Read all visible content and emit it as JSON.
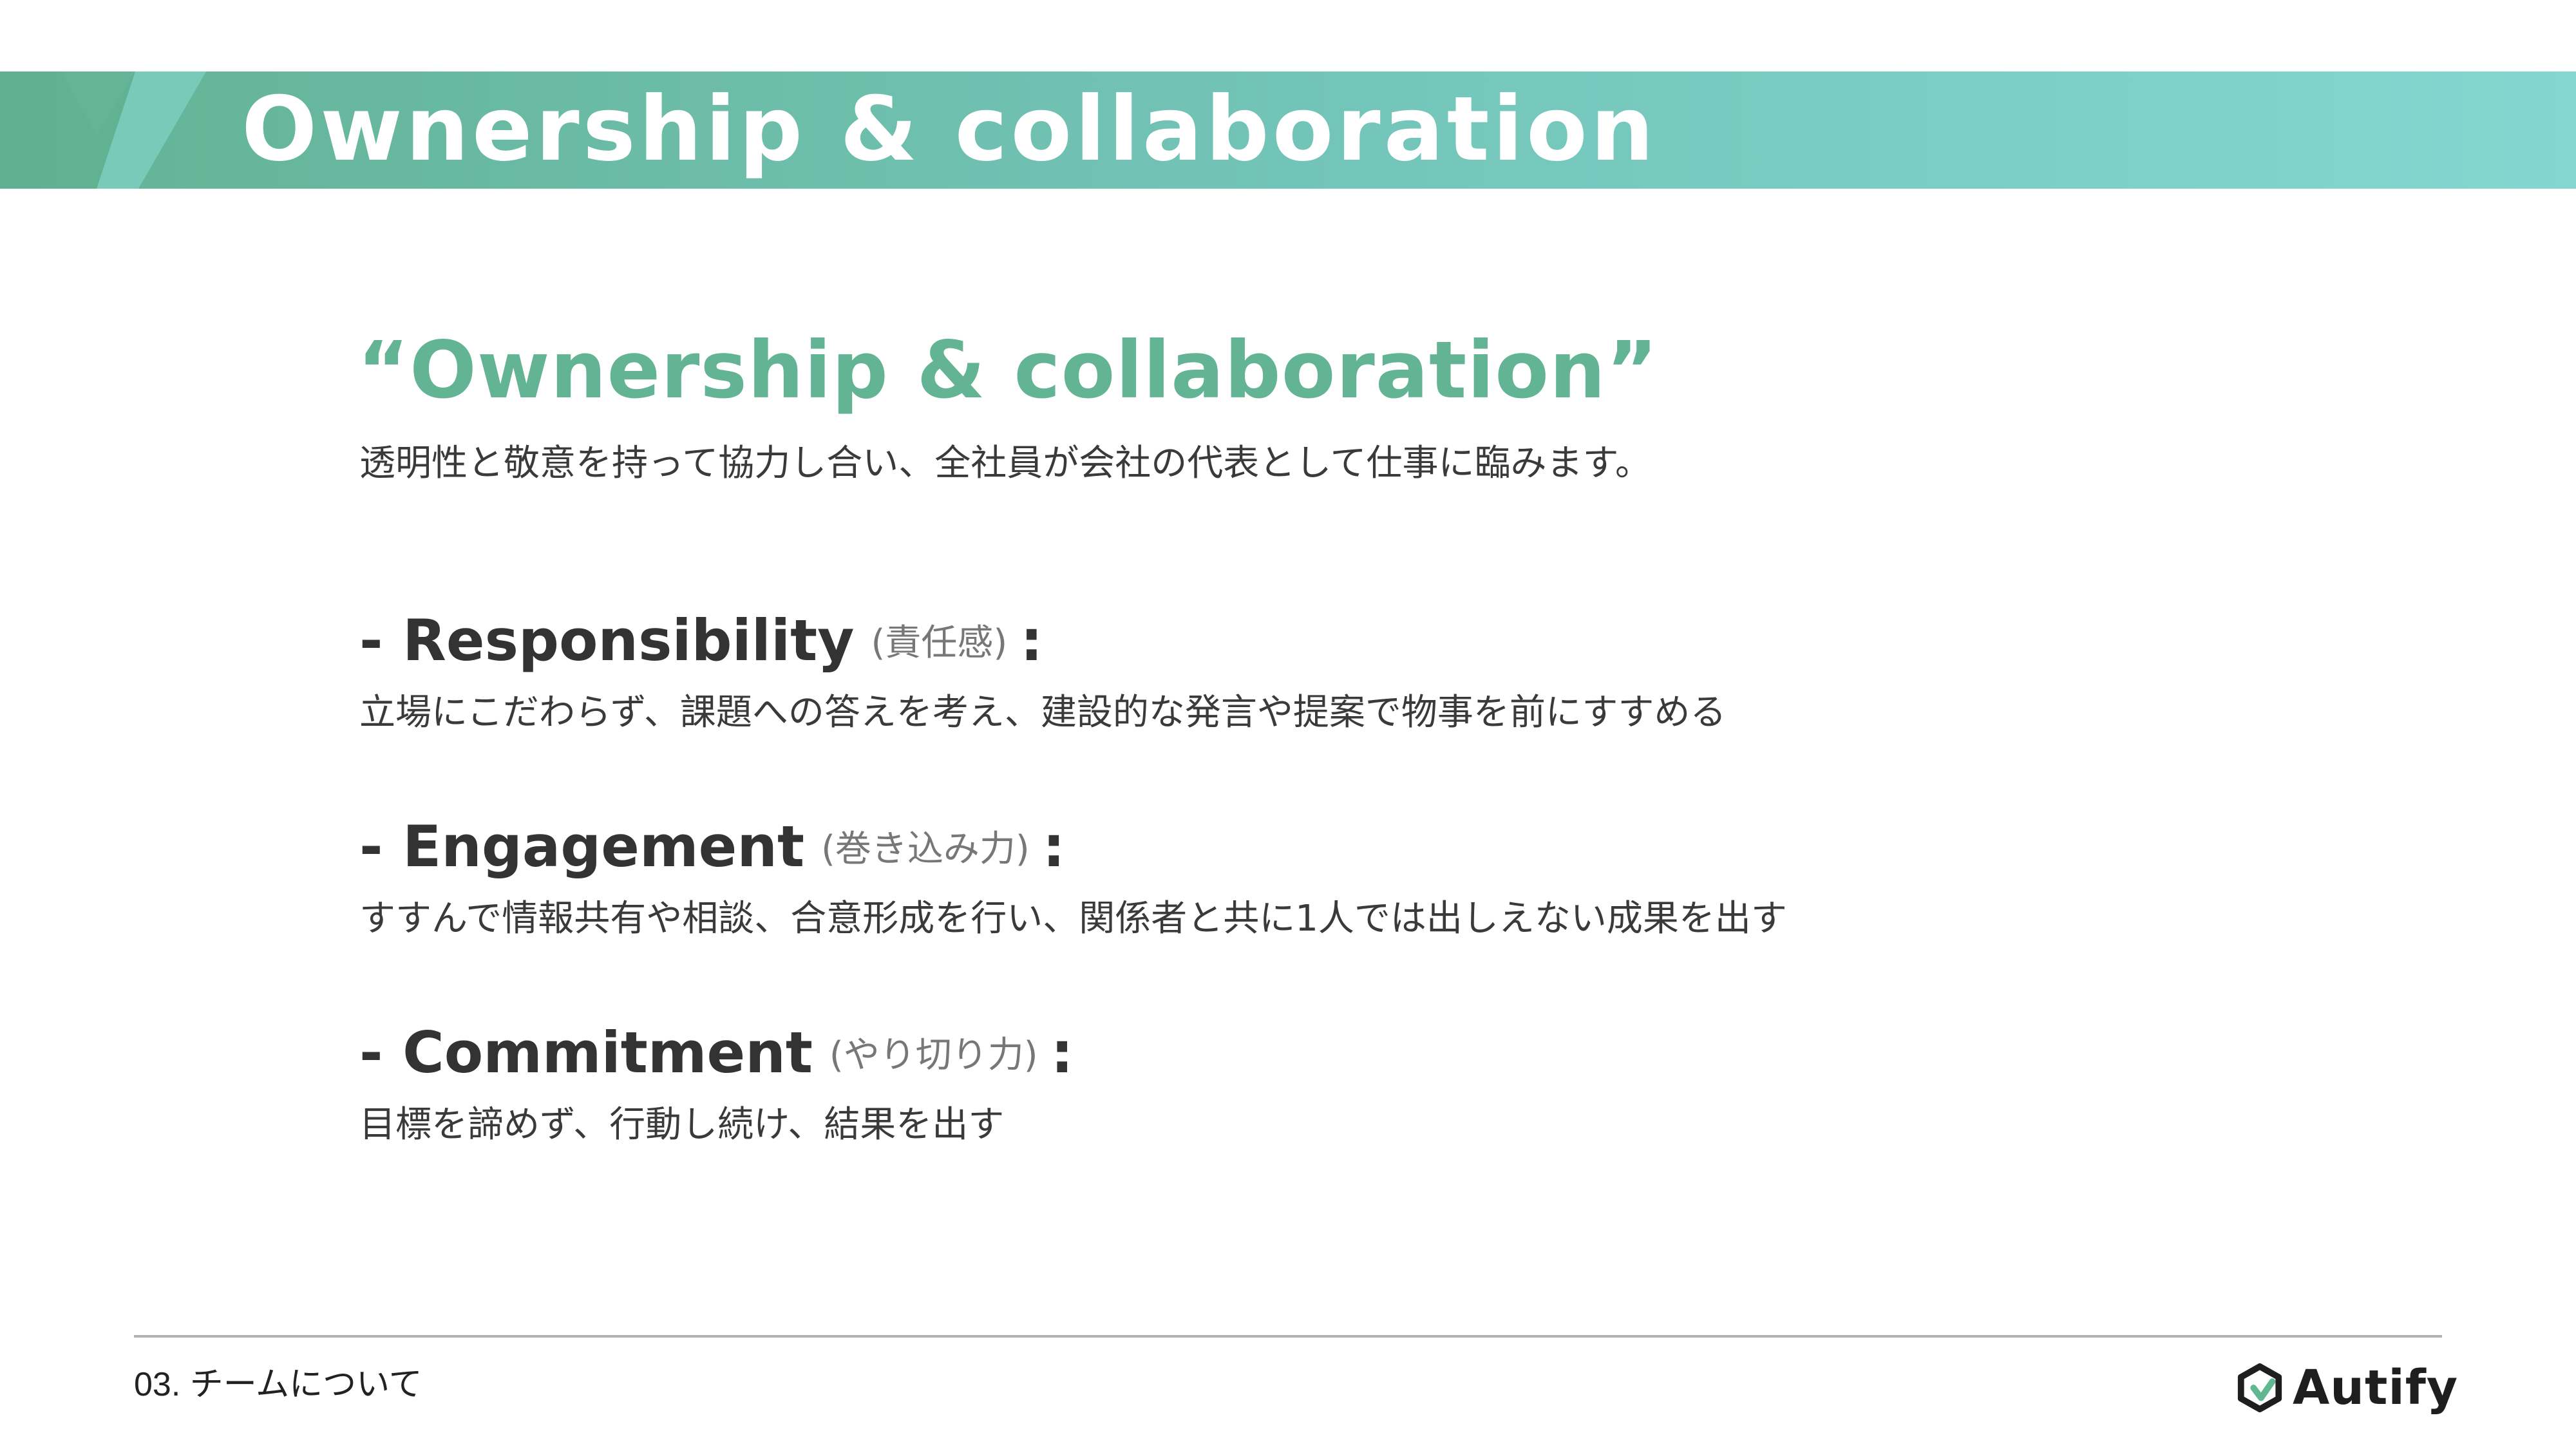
{
  "header": {
    "title": "Ownership & collaboration"
  },
  "main": {
    "quote_title": "“Ownership & collaboration”",
    "quote_description": "透明性と敬意を持って協力し合い、全社員が会社の代表として仕事に臨みます。",
    "values": [
      {
        "title": "- Responsibility",
        "subtitle": "(責任感)",
        "colon": ":",
        "description": "立場にこだわらず、課題への答えを考え、建設的な発言や提案で物事を前にすすめる"
      },
      {
        "title": "- Engagement",
        "subtitle": "(巻き込み力)",
        "colon": ":",
        "description": "すすんで情報共有や相談、合意形成を行い、関係者と共に1人では出しえない成果を出す"
      },
      {
        "title": "- Commitment",
        "subtitle": "(やり切り力)",
        "colon": ":",
        "description": "目標を諦めず、行動し続け、結果を出す"
      }
    ]
  },
  "footer": {
    "section": "03. チームについて",
    "logo_text": "Autify"
  },
  "colors": {
    "accent_green": "#63b395",
    "banner_end": "#83d7d0",
    "text_dark": "#333333",
    "text_muted": "#777777"
  }
}
